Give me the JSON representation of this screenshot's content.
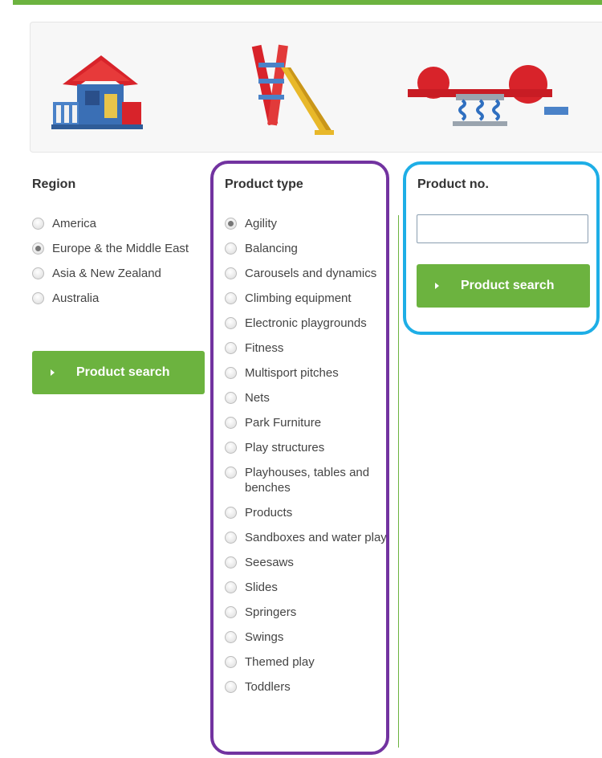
{
  "region": {
    "title": "Region",
    "options": [
      {
        "label": "America",
        "checked": false
      },
      {
        "label": "Europe & the Middle East",
        "checked": true
      },
      {
        "label": "Asia & New Zealand",
        "checked": false
      },
      {
        "label": "Australia",
        "checked": false
      }
    ],
    "button_label": "Product search"
  },
  "product_type": {
    "title": "Product type",
    "options": [
      {
        "label": "Agility",
        "checked": true
      },
      {
        "label": "Balancing",
        "checked": false
      },
      {
        "label": "Carousels and dynamics",
        "checked": false
      },
      {
        "label": "Climbing equipment",
        "checked": false
      },
      {
        "label": "Electronic playgrounds",
        "checked": false
      },
      {
        "label": "Fitness",
        "checked": false
      },
      {
        "label": "Multisport pitches",
        "checked": false
      },
      {
        "label": "Nets",
        "checked": false
      },
      {
        "label": "Park Furniture",
        "checked": false
      },
      {
        "label": "Play structures",
        "checked": false
      },
      {
        "label": "Playhouses, tables and benches",
        "checked": false
      },
      {
        "label": "Products",
        "checked": false
      },
      {
        "label": "Sandboxes and water play",
        "checked": false
      },
      {
        "label": "Seesaws",
        "checked": false
      },
      {
        "label": "Slides",
        "checked": false
      },
      {
        "label": "Springers",
        "checked": false
      },
      {
        "label": "Swings",
        "checked": false
      },
      {
        "label": "Themed play",
        "checked": false
      },
      {
        "label": "Toddlers",
        "checked": false
      }
    ]
  },
  "product_no": {
    "title": "Product no.",
    "input_value": "",
    "button_label": "Product search"
  },
  "banner": {
    "images": [
      "playhouse-image",
      "slide-image",
      "springer-image"
    ]
  },
  "colors": {
    "accent_green": "#6cb33f",
    "highlight_purple": "#7233a0",
    "highlight_blue": "#1eaee6"
  }
}
